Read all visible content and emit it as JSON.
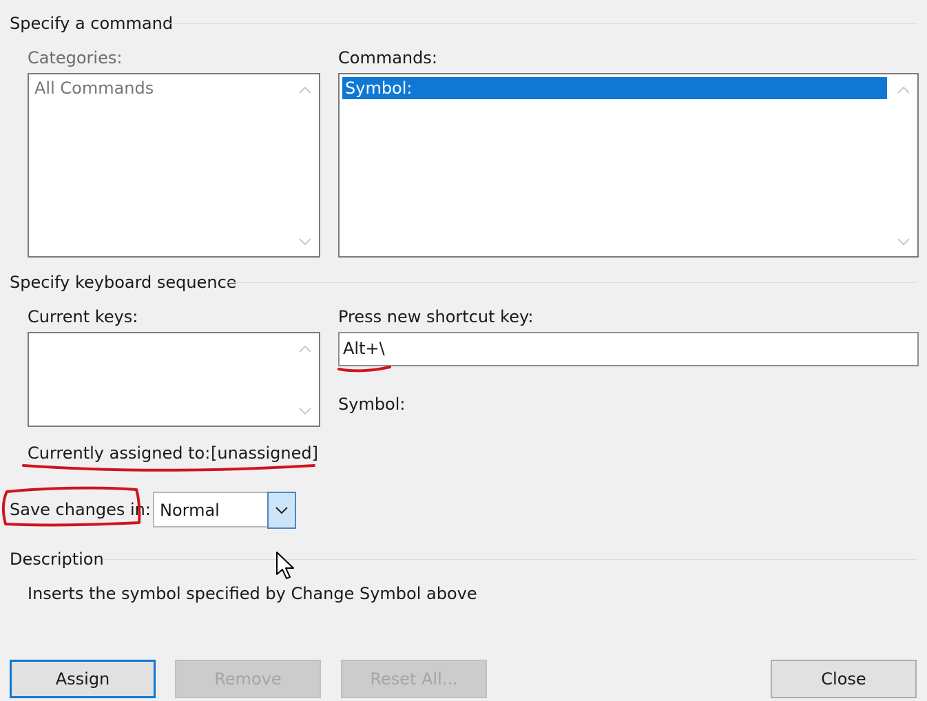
{
  "specify_command": {
    "section_title": "Specify a command",
    "categories": {
      "label": "Categories:",
      "items": [
        "All Commands"
      ]
    },
    "commands": {
      "label": "Commands:",
      "items": [
        "Symbol:"
      ],
      "selected_index": 0
    }
  },
  "keyboard_sequence": {
    "section_title": "Specify keyboard sequence",
    "current_keys": {
      "label": "Current keys:",
      "items": []
    },
    "new_shortcut": {
      "label": "Press new shortcut key:",
      "value": "Alt+\\"
    },
    "symbol_label": "Symbol:",
    "currently_assigned": {
      "label": "Currently assigned to:",
      "value": "[unassigned]"
    },
    "save_changes": {
      "label": "Save changes in:",
      "value": "Normal"
    }
  },
  "description": {
    "section_title": "Description",
    "text": "Inserts the symbol specified by Change Symbol above"
  },
  "buttons": {
    "assign": "Assign",
    "remove": "Remove",
    "reset_all": "Reset All...",
    "close": "Close"
  },
  "icons": {
    "scroll_up": "chevron-up-icon",
    "scroll_down": "chevron-down-icon",
    "dropdown": "chevron-down-icon",
    "cursor": "mouse-pointer-icon"
  },
  "colors": {
    "selection": "#0e78d4",
    "annotation": "#d0141e",
    "dropdown_bg": "#cce4f7"
  }
}
